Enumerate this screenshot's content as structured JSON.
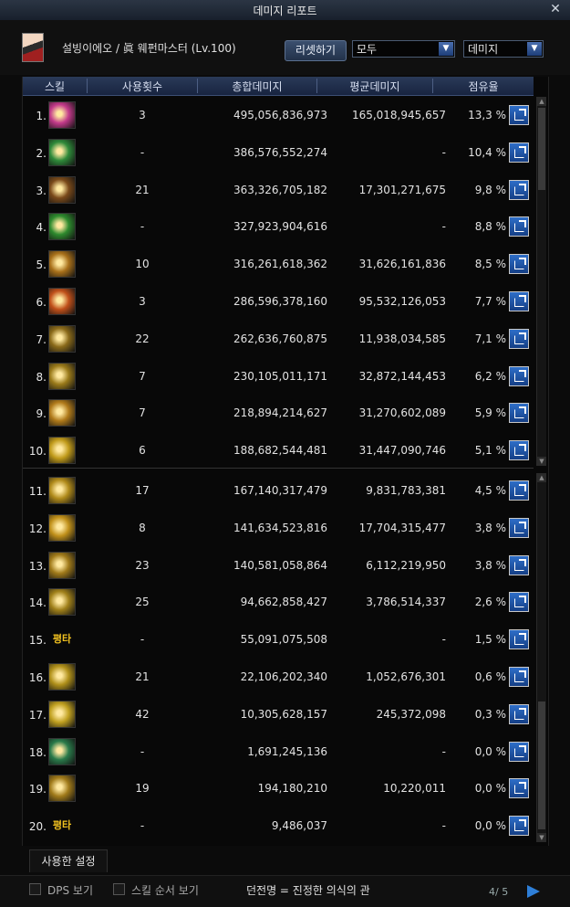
{
  "window": {
    "title": "데미지 리포트",
    "close_icon": "close-icon"
  },
  "header": {
    "character": "설빙이에오 / 眞 웨펀마스터 (Lv.100)",
    "reset_label": "리셋하기",
    "filter_value": "모두",
    "type_value": "데미지"
  },
  "columns": [
    "스킬",
    "사용횟수",
    "총합데미지",
    "평균데미지",
    "점유율"
  ],
  "rows": [
    {
      "rank": "1.",
      "icon": "slash-burst-icon",
      "icon_text": "",
      "uses": "3",
      "total": "495,056,836,973",
      "avg": "165,018,945,657",
      "share": "13,3 %",
      "color": "#c23a8a"
    },
    {
      "rank": "2.",
      "icon": "kanji-sword-icon",
      "icon_text": "",
      "uses": "-",
      "total": "386,576,552,274",
      "avg": "-",
      "share": "10,4 %",
      "color": "#2f8a3a"
    },
    {
      "rank": "3.",
      "icon": "arc-slash-icon",
      "icon_text": "",
      "uses": "21",
      "total": "363,326,705,182",
      "avg": "17,301,271,675",
      "share": "9,8 %",
      "color": "#7a4a1a"
    },
    {
      "rank": "4.",
      "icon": "green-blade-icon",
      "icon_text": "",
      "uses": "-",
      "total": "327,923,904,616",
      "avg": "-",
      "share": "8,8 %",
      "color": "#2e8a2e"
    },
    {
      "rank": "5.",
      "icon": "whirl-slash-icon",
      "icon_text": "",
      "uses": "10",
      "total": "316,261,618,362",
      "avg": "31,626,161,836",
      "share": "8,5 %",
      "color": "#a8701a"
    },
    {
      "rank": "6.",
      "icon": "flame-burst-icon",
      "icon_text": "",
      "uses": "3",
      "total": "286,596,378,160",
      "avg": "95,532,126,053",
      "share": "7,7 %",
      "color": "#c0501a"
    },
    {
      "rank": "7.",
      "icon": "flow-strike-icon",
      "icon_text": "",
      "uses": "22",
      "total": "262,636,760,875",
      "avg": "11,938,034,585",
      "share": "7,1 %",
      "color": "#8a6a1a"
    },
    {
      "rank": "8.",
      "icon": "cross-slash-icon",
      "icon_text": "",
      "uses": "7",
      "total": "230,105,011,171",
      "avg": "32,872,144,453",
      "share": "6,2 %",
      "color": "#9a7a1a"
    },
    {
      "rank": "9.",
      "icon": "wave-slash-icon",
      "icon_text": "",
      "uses": "7",
      "total": "218,894,214,627",
      "avg": "31,270,602,089",
      "share": "5,9 %",
      "color": "#b07a1a"
    },
    {
      "rank": "10.",
      "icon": "spark-burst-icon",
      "icon_text": "",
      "uses": "6",
      "total": "188,682,544,481",
      "avg": "31,447,090,746",
      "share": "5,1 %",
      "color": "#c09a1a"
    },
    {
      "rank": "11.",
      "icon": "dragon-strike-icon",
      "icon_text": "",
      "uses": "17",
      "total": "167,140,317,479",
      "avg": "9,831,783,381",
      "share": "4,5 %",
      "color": "#b08a1a"
    },
    {
      "rank": "12.",
      "icon": "crescent-slash-icon",
      "icon_text": "",
      "uses": "8",
      "total": "141,634,523,816",
      "avg": "17,704,315,477",
      "share": "3,8 %",
      "color": "#c0901a"
    },
    {
      "rank": "13.",
      "icon": "flow-arc-icon",
      "icon_text": "",
      "uses": "23",
      "total": "140,581,058,864",
      "avg": "6,112,219,950",
      "share": "3,8 %",
      "color": "#a07a1a"
    },
    {
      "rank": "14.",
      "icon": "flow-wave-icon",
      "icon_text": "",
      "uses": "25",
      "total": "94,662,858,427",
      "avg": "3,786,514,337",
      "share": "2,6 %",
      "color": "#a0801a"
    },
    {
      "rank": "15.",
      "icon": "",
      "icon_text": "평타",
      "uses": "-",
      "total": "55,091,075,508",
      "avg": "-",
      "share": "1,5 %",
      "color": ""
    },
    {
      "rank": "16.",
      "icon": "coil-slash-icon",
      "icon_text": "",
      "uses": "21",
      "total": "22,106,202,340",
      "avg": "1,052,676,301",
      "share": "0,6 %",
      "color": "#b0901a"
    },
    {
      "rank": "17.",
      "icon": "leap-strike-icon",
      "icon_text": "",
      "uses": "42",
      "total": "10,305,628,157",
      "avg": "245,372,098",
      "share": "0,3 %",
      "color": "#c0a020"
    },
    {
      "rank": "18.",
      "icon": "green-whirl-icon",
      "icon_text": "",
      "uses": "-",
      "total": "1,691,245,136",
      "avg": "-",
      "share": "0,0 %",
      "color": "#2a7a4a"
    },
    {
      "rank": "19.",
      "icon": "spiral-slash-icon",
      "icon_text": "",
      "uses": "19",
      "total": "194,180,210",
      "avg": "10,220,011",
      "share": "0,0 %",
      "color": "#a07a1a"
    },
    {
      "rank": "20.",
      "icon": "",
      "icon_text": "평타",
      "uses": "-",
      "total": "9,486,037",
      "avg": "-",
      "share": "0,0 %",
      "color": ""
    }
  ],
  "tabs": {
    "setting": "사용한 설정"
  },
  "footer": {
    "dps_label": "DPS 보기",
    "order_label": "스킬 순서 보기",
    "dungeon": "던전명 = 진정한 의식의 관",
    "page": "4/ 5"
  }
}
